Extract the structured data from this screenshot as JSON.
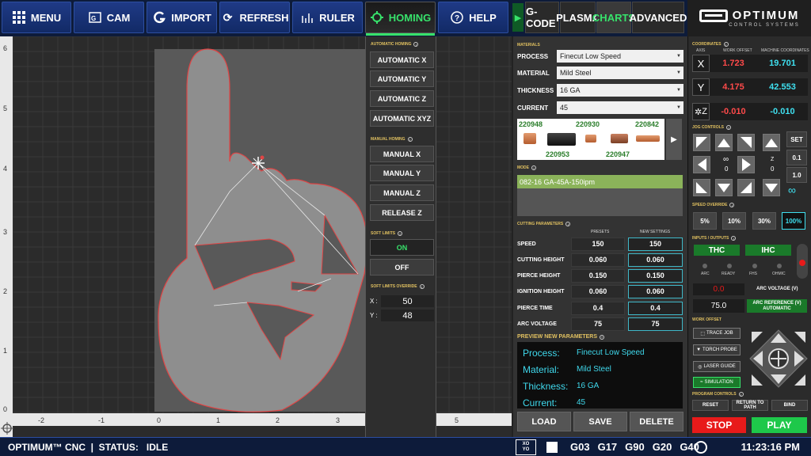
{
  "toolbar": {
    "menu": "MENU",
    "cam": "CAM",
    "import": "IMPORT",
    "refresh": "REFRESH",
    "ruler": "RULER",
    "homing": "HOMING",
    "help": "HELP"
  },
  "tabs": {
    "gcode": "G-CODE",
    "plasma": "PLASMA",
    "charts": "CHARTS",
    "advanced": "ADVANCED"
  },
  "logo": {
    "name": "OPTIMUM",
    "sub": "CONTROL SYSTEMS"
  },
  "canvas": {
    "x_ticks": [
      "-2",
      "-1",
      "0",
      "1",
      "2",
      "3",
      "5"
    ],
    "y_ticks": [
      "6",
      "5",
      "4",
      "3",
      "2",
      "1",
      "0"
    ]
  },
  "homing": {
    "auto_title": "AUTOMATIC HOMING",
    "auto_x": "AUTOMATIC X",
    "auto_y": "AUTOMATIC Y",
    "auto_z": "AUTOMATIC Z",
    "auto_xyz": "AUTOMATIC XYZ",
    "manual_title": "MANUAL HOMING",
    "manual_x": "MANUAL X",
    "manual_y": "MANUAL Y",
    "manual_z": "MANUAL Z",
    "release_z": "RELEASE Z",
    "soft_title": "SOFT LIMITS",
    "on": "ON",
    "off": "OFF",
    "override_title": "SOFT LIMITS OVERRIDE",
    "x_label": "X :",
    "x_value": "50",
    "y_label": "Y :",
    "y_value": "48"
  },
  "materials": {
    "title": "MATERIALS",
    "process_label": "PROCESS",
    "process": "Finecut Low Speed",
    "material_label": "MATERIAL",
    "material": "Mild Steel",
    "thickness_label": "THICKNESS",
    "thickness": "16 GA",
    "current_label": "CURRENT",
    "current": "45",
    "consumables": [
      "220948",
      "220930",
      "220842",
      "220953",
      "220947"
    ]
  },
  "mode": {
    "title": "MODE",
    "value": "082-16 GA-45A-150ipm"
  },
  "cutting": {
    "title": "CUTTING PARAMETERS",
    "presets_head": "PRESETS",
    "new_head": "NEW SETTINGS",
    "rows": [
      {
        "label": "SPEED",
        "preset": "150",
        "new": "150"
      },
      {
        "label": "CUTTING HEIGHT",
        "preset": "0.060",
        "new": "0.060"
      },
      {
        "label": "PIERCE HEIGHT",
        "preset": "0.150",
        "new": "0.150"
      },
      {
        "label": "IGNITION HEIGHT",
        "preset": "0.060",
        "new": "0.060"
      },
      {
        "label": "PIERCE TIME",
        "preset": "0.4",
        "new": "0.4"
      },
      {
        "label": "ARC VOLTAGE",
        "preset": "75",
        "new": "75"
      }
    ]
  },
  "preview": {
    "title": "PREVIEW NEW PARAMETERS",
    "rows": [
      {
        "k": "Process:",
        "v": "Finecut Low Speed"
      },
      {
        "k": "Material:",
        "v": "Mild Steel"
      },
      {
        "k": "Thickness:",
        "v": "16 GA"
      },
      {
        "k": "Current:",
        "v": "45"
      }
    ]
  },
  "actions": {
    "load": "LOAD",
    "save": "SAVE",
    "delete": "DELETE"
  },
  "coords": {
    "title": "COORDINATES",
    "axis_head": "AXIS",
    "wo_head": "WORK OFFSET",
    "mc_head": "MACHINE COORDINATES",
    "rows": [
      {
        "axis": "X",
        "wo": "1.723",
        "mc": "19.701"
      },
      {
        "axis": "Y",
        "wo": "4.175",
        "mc": "42.553"
      },
      {
        "axis": "Z",
        "wo": "-0.010",
        "mc": "-0.010"
      }
    ]
  },
  "jog": {
    "title": "JOG CONTROLS",
    "inf": "∞",
    "zero_a": "0",
    "z_label": "Z",
    "zero_b": "0",
    "set": "SET",
    "step1": "0.1",
    "step2": "1.0",
    "cont": "∞"
  },
  "speed_override": {
    "title": "SPEED OVERRIDE",
    "options": [
      "5%",
      "10%",
      "30%",
      "100%"
    ]
  },
  "io": {
    "title": "INPUTS / OUTPUTS",
    "thc": "THC",
    "ihc": "IHC",
    "leds": [
      "ARC",
      "READY",
      "FHS",
      "OHMIC"
    ],
    "arc_voltage_value": "0.0",
    "arc_voltage_label": "ARC VOLTAGE (V)",
    "arc_ref_value": "75.0",
    "arc_ref_label": "ARC REFERENCE (V) AUTOMATIC"
  },
  "work_offset": {
    "title": "WORK OFFSET",
    "trace": "TRACE JOB",
    "probe": "TORCH PROBE",
    "laser": "LASER GUIDE",
    "sim": "SIMULATION"
  },
  "program": {
    "title": "PROGRAM CONTROLS",
    "reset": "RESET",
    "return": "RETURN TO PATH",
    "bind": "BIND",
    "stop": "STOP",
    "play": "PLAY"
  },
  "status": {
    "left": "OPTIMUM™ CNC  |  STATUS:   IDLE",
    "xy_top": "XO",
    "xy_bot": "YO",
    "gcodes": [
      "G03",
      "G17",
      "G90",
      "G20",
      "G40"
    ],
    "time": "11:23:16 PM"
  },
  "colors": {
    "accent_green": "#37e26b",
    "toolbar_blue": "#1f3a86",
    "cyan": "#3fe0f0",
    "red": "#ff4a4a"
  }
}
